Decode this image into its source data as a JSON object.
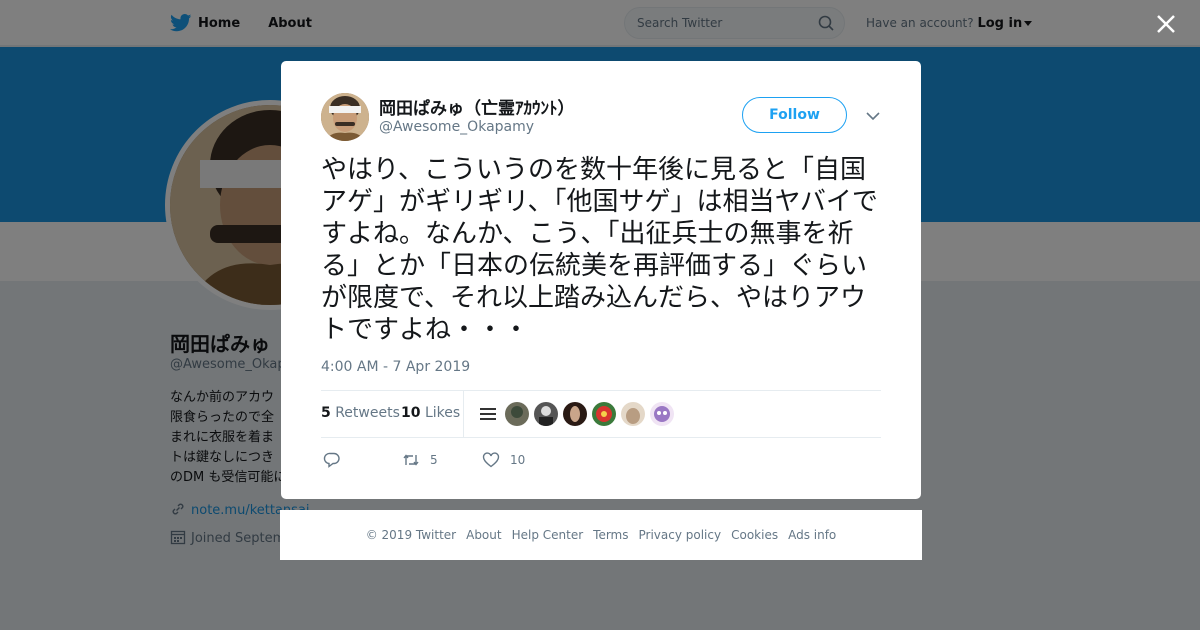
{
  "nav": {
    "home": "Home",
    "about": "About",
    "search_placeholder": "Search Twitter",
    "have_account": "Have an account?",
    "login": "Log in"
  },
  "profile": {
    "name": "岡田ぱみゅ",
    "handle": "@Awesome_Okap",
    "bio_lines": [
      "なんか前のアカウ",
      "限食らったので全",
      "まれに衣服を着ま",
      "トは鍵なしにつき",
      "のDM も受信可能に"
    ],
    "link": "note.mu/kettansai",
    "joined": "Joined Septem"
  },
  "tweet": {
    "author_name": "岡田ぱみゅ（亡霊ｱｶｳﾝﾄ）",
    "author_handle": "@Awesome_Okapamy",
    "follow_label": "Follow",
    "text": "やはり、こういうのを数十年後に見ると「自国アゲ」がギリギリ、「他国サゲ」は相当ヤバイですよね。なんか、こう、「出征兵士の無事を祈る」とか「日本の伝統美を再評価する」ぐらいが限度で、それ以上踏み込んだら、やはりアウトですよね・・・",
    "timestamp": "4:00 AM - 7 Apr 2019",
    "retweets_count": "5",
    "retweets_label": "Retweets",
    "likes_count": "10",
    "likes_label": "Likes",
    "action_retweet_count": "5",
    "action_like_count": "10"
  },
  "footer": {
    "copyright": "© 2019 Twitter",
    "about": "About",
    "help": "Help Center",
    "terms": "Terms",
    "privacy": "Privacy policy",
    "cookies": "Cookies",
    "ads": "Ads info"
  },
  "colors": {
    "brand_blue": "#1da1f2",
    "banner_blue": "#1b95e0",
    "overlay": "rgba(0,0,0,0.5)"
  },
  "icons": [
    "twitter-bird-icon",
    "search-icon",
    "close-icon",
    "link-icon",
    "calendar-icon",
    "reply-icon",
    "retweet-icon",
    "heart-icon",
    "chevron-down-icon"
  ]
}
